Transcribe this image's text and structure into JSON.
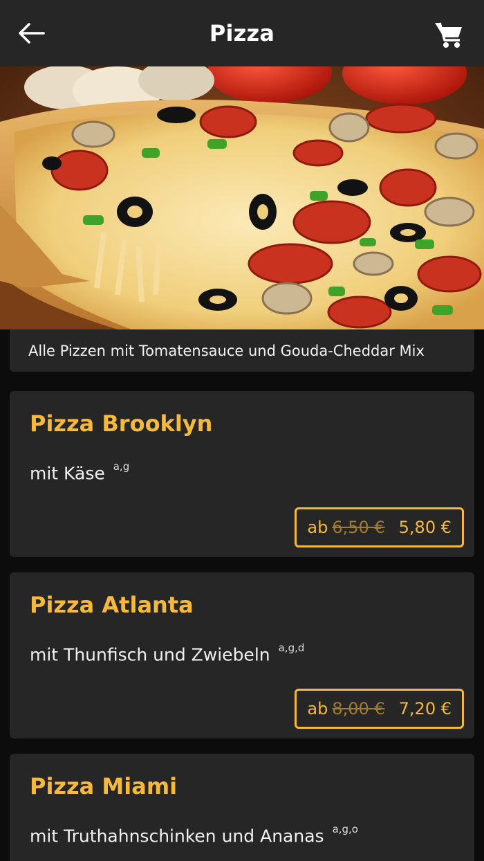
{
  "header": {
    "title": "Pizza",
    "back_icon": "arrow-left-icon",
    "cart_icon": "cart-icon"
  },
  "hero": {
    "image": "pizza-photo"
  },
  "info": {
    "text": "Alle Pizzen mit Tomatensauce und Gouda-Cheddar Mix"
  },
  "items": [
    {
      "name": "Pizza Brooklyn",
      "desc": "mit Käse",
      "allergens": "a,g",
      "prefix": "ab",
      "old_price": "6,50 €",
      "price": "5,80 €"
    },
    {
      "name": "Pizza Atlanta",
      "desc": "mit Thunfisch und Zwiebeln",
      "allergens": "a,g,d",
      "prefix": "ab",
      "old_price": "8,00 €",
      "price": "7,20 €"
    },
    {
      "name": "Pizza Miami",
      "desc": "mit Truthahnschinken und Ananas",
      "allergens": "a,g,o"
    }
  ],
  "colors": {
    "accent": "#f6b93b",
    "card": "#262626",
    "background": "#0c0c0c"
  }
}
